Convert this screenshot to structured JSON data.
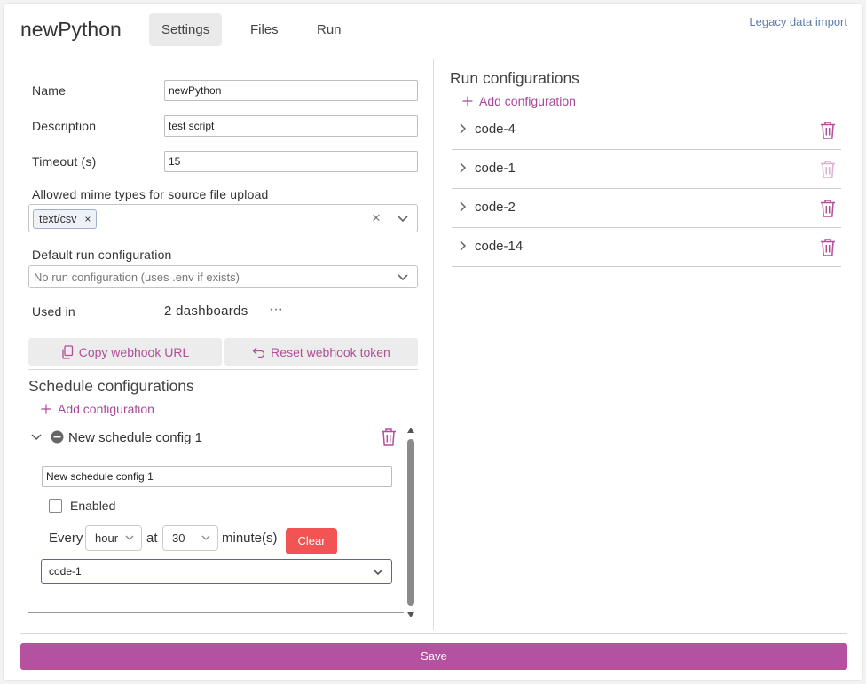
{
  "header": {
    "app_title": "newPython",
    "tabs": [
      {
        "label": "Settings",
        "active": true
      },
      {
        "label": "Files",
        "active": false
      },
      {
        "label": "Run",
        "active": false
      }
    ],
    "legacy_link": "Legacy data import"
  },
  "form": {
    "name_label": "Name",
    "name_value": "newPython",
    "description_label": "Description",
    "description_value": "test script",
    "timeout_label": "Timeout (s)",
    "timeout_value": "15",
    "mime_label": "Allowed mime types for source file upload",
    "mime_chips": [
      "text/csv"
    ],
    "chip_remove": "×",
    "clear_symbol": "×",
    "default_run_label": "Default run configuration",
    "default_run_placeholder": "No run configuration (uses .env if exists)",
    "used_in_label": "Used in",
    "used_in_value": "2 dashboards",
    "more_symbol": "···",
    "copy_webhook_label": "Copy webhook URL",
    "reset_webhook_label": "Reset webhook token"
  },
  "schedule": {
    "title": "Schedule configurations",
    "add_label": "Add configuration",
    "config_title": "New schedule config 1",
    "name_value": "New schedule config 1",
    "enabled_label": "Enabled",
    "every_label": "Every",
    "interval_value": "hour",
    "at_label": "at",
    "minute_value": "30",
    "minutes_label": "minute(s)",
    "clear_label": "Clear",
    "run_config_value": "code-1"
  },
  "run_configurations": {
    "title": "Run configurations",
    "add_label": "Add configuration",
    "items": [
      {
        "label": "code-4",
        "deletable": true
      },
      {
        "label": "code-1",
        "deletable": false
      },
      {
        "label": "code-2",
        "deletable": true
      },
      {
        "label": "code-14",
        "deletable": true
      }
    ]
  },
  "footer": {
    "save_label": "Save"
  },
  "colors": {
    "accent": "#b5529f",
    "link": "#a9489b",
    "danger": "#f25353",
    "legacy_link": "#5a7ca8"
  }
}
